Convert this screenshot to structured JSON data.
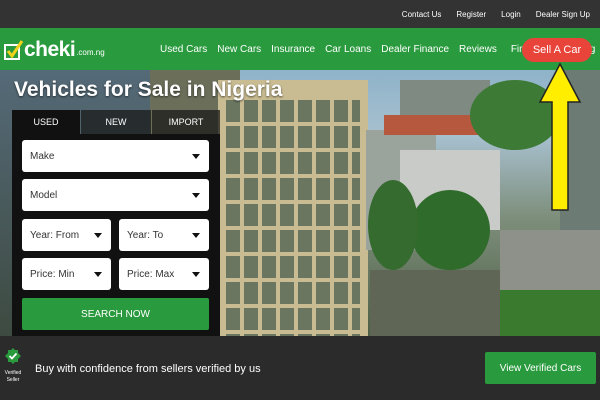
{
  "topbar": {
    "links": [
      "Contact Us",
      "Register",
      "Login",
      "Dealer Sign Up"
    ]
  },
  "brand": {
    "name": "cheki",
    "tld": ".com.ng"
  },
  "nav": {
    "items": [
      "Used Cars",
      "New Cars",
      "Insurance",
      "Car Loans",
      "Dealer Finance",
      "Reviews",
      "Find My Car",
      "Blog"
    ],
    "cta": "Sell A Car"
  },
  "hero": {
    "title": "Vehicles for Sale in Nigeria"
  },
  "search": {
    "tabs": [
      "USED",
      "NEW",
      "IMPORT"
    ],
    "active_tab": "USED",
    "make": "Make",
    "model": "Model",
    "year_from": "Year: From",
    "year_to": "Year: To",
    "price_min": "Price: Min",
    "price_max": "Price: Max",
    "submit": "SEARCH NOW"
  },
  "footer_bar": {
    "badge_label_1": "Verified",
    "badge_label_2": "Seller",
    "message": "Buy with confidence from sellers verified by us",
    "cta": "View Verified Cars"
  },
  "colors": {
    "brand_green": "#2a9a3e",
    "cta_red": "#e8443a",
    "arrow_yellow": "#ffee00",
    "dark": "#2b2b2b"
  }
}
